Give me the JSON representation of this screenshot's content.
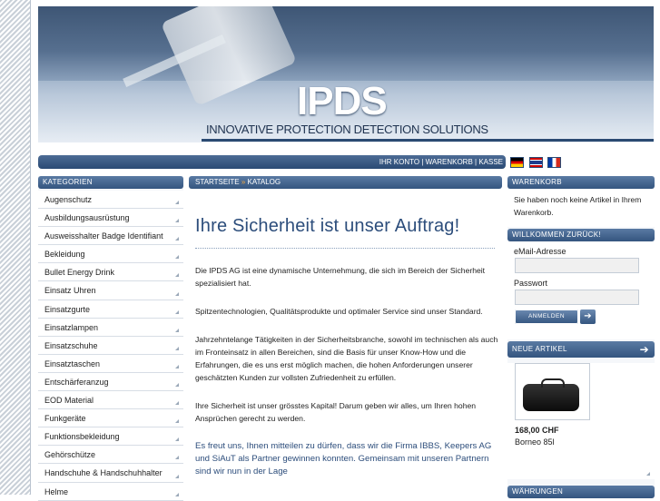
{
  "brand": {
    "logo": "IPDS",
    "tagline": "INNOVATIVE PROTECTION DETECTION SOLUTIONS"
  },
  "topnav": {
    "account": "IHR KONTO",
    "cart": "WARENKORB",
    "checkout": "KASSE",
    "separator": " | "
  },
  "languages": [
    "de",
    "en",
    "fr"
  ],
  "categories": {
    "heading": "KATEGORIEN",
    "items": [
      "Augenschutz",
      "Ausbildungsausrüstung",
      "Ausweisshalter Badge Identifiant",
      "Bekleidung",
      "Bullet Energy Drink",
      "Einsatz Uhren",
      "Einsatzgurte",
      "Einsatzlampen",
      "Einsatzschuhe",
      "Einsatztaschen",
      "Entschärferanzug",
      "EOD Material",
      "Funkgeräte",
      "Funktionsbekleidung",
      "Gehörschütze",
      "Handschuhe & Handschuhhalter",
      "Helme"
    ]
  },
  "breadcrumb": {
    "home": "STARTSEITE",
    "sep": " » ",
    "current": "KATALOG"
  },
  "content": {
    "title": "Ihre Sicherheit ist unser Auftrag!",
    "p1": "Die IPDS AG ist eine dynamische Unternehmung, die sich im Bereich der Sicherheit spezialisiert hat.",
    "p2": "Spitzentechnologien, Qualitätsprodukte und optimaler Service sind unser Standard.",
    "p3": "Jahrzehntelange Tätigkeiten in der Sicherheitsbranche, sowohl im technischen als auch im Fronteinsatz in allen Bereichen, sind die Basis für unser Know-How und die Erfahrungen, die es uns erst möglich machen, die hohen Anforderungen unserer geschätzten Kunden zur vollsten Zufriedenheit zu erfüllen.",
    "p4": "Ihre Sicherheit ist unser grösstes Kapital! Darum geben wir alles, um Ihren hohen Ansprüchen gerecht zu werden.",
    "p5": "Es freut uns, Ihnen mitteilen zu dürfen, dass wir die Firma IBBS,  Keepers AG und SiAuT als Partner gewinnen konnten. Gemeinsam mit unseren Partnern sind wir nun in der Lage"
  },
  "cart": {
    "heading": "WARENKORB",
    "empty_text": "Sie haben noch keine Artikel in Ihrem Warenkorb."
  },
  "login": {
    "heading": "WILLKOMMEN ZURÜCK!",
    "email_label": "eMail-Adresse",
    "password_label": "Passwort",
    "button": "ANMELDEN",
    "email_value": "",
    "password_value": ""
  },
  "new_products": {
    "heading": "NEUE ARTIKEL",
    "price": "168,00 CHF",
    "name": "Borneo 85l"
  },
  "currencies": {
    "heading": "WÄHRUNGEN"
  },
  "colors": {
    "accent": "#2c4d7b",
    "bar": "#34557f"
  }
}
